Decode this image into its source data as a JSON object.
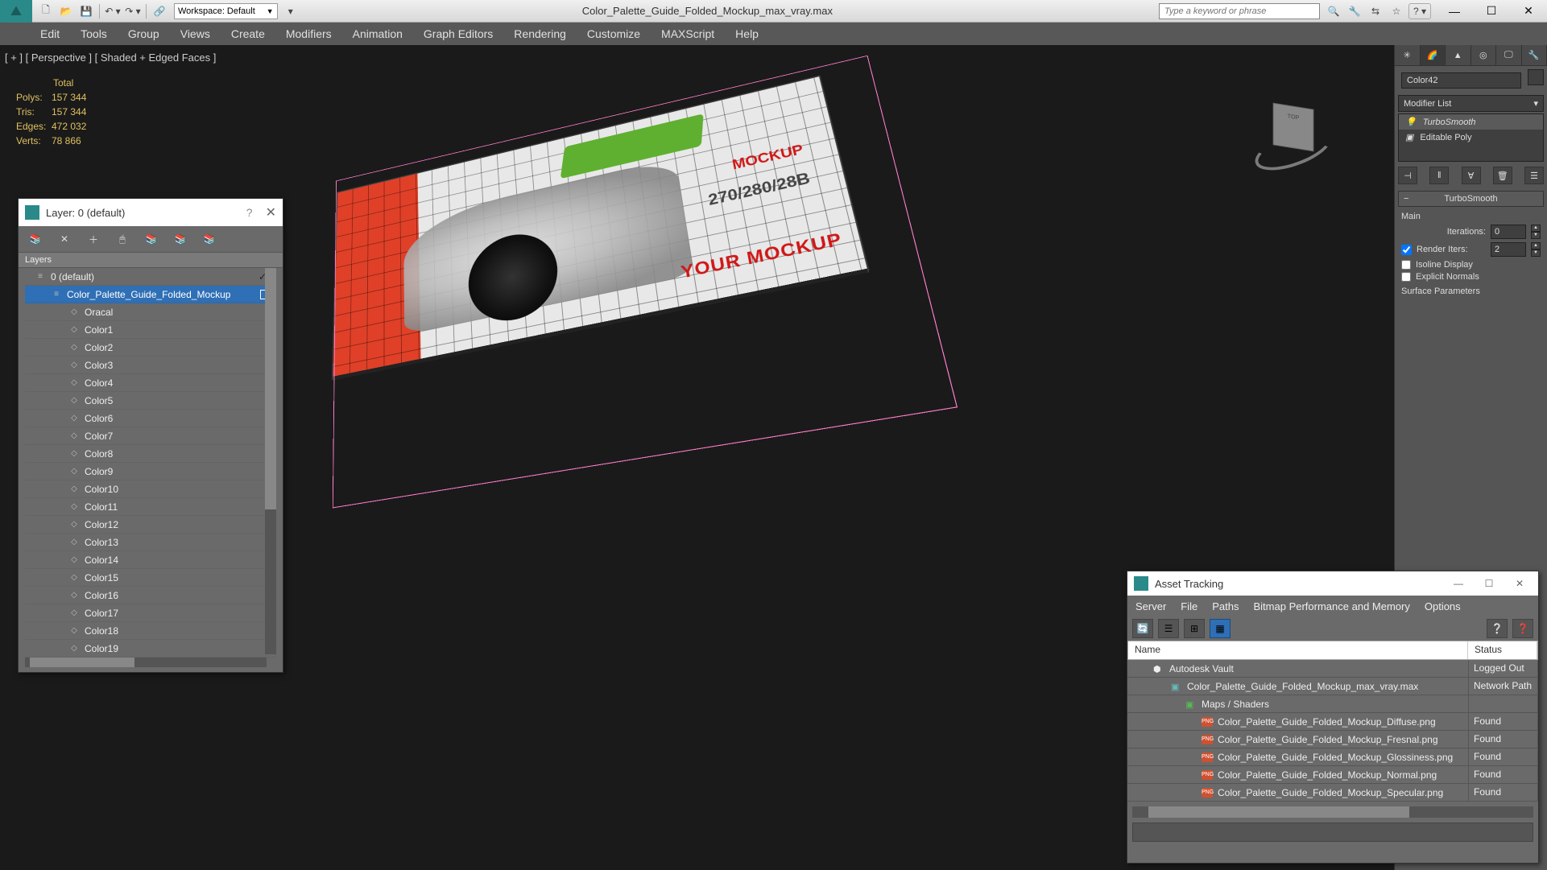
{
  "titlebar": {
    "workspace_label": "Workspace: Default",
    "filename": "Color_Palette_Guide_Folded_Mockup_max_vray.max",
    "search_placeholder": "Type a keyword or phrase"
  },
  "menubar": [
    "Edit",
    "Tools",
    "Group",
    "Views",
    "Create",
    "Modifiers",
    "Animation",
    "Graph Editors",
    "Rendering",
    "Customize",
    "MAXScript",
    "Help"
  ],
  "viewport": {
    "label": "[ + ] [ Perspective ] [ Shaded + Edged Faces ]",
    "stats": {
      "total_label": "Total",
      "polys_label": "Polys:",
      "polys": "157 344",
      "tris_label": "Tris:",
      "tris": "157 344",
      "edges_label": "Edges:",
      "edges": "472 032",
      "verts_label": "Verts:",
      "verts": "78 866"
    },
    "mockup_text1": "YOUR MOCKUP",
    "mockup_text2": "MOCKUP",
    "num_text": "270/280/28B"
  },
  "cmdpanel": {
    "object_name": "Color42",
    "modifier_list_label": "Modifier List",
    "stack": [
      "TurboSmooth",
      "Editable Poly"
    ],
    "rollout_title": "TurboSmooth",
    "main_label": "Main",
    "iterations_label": "Iterations:",
    "iterations_value": "0",
    "render_iters_label": "Render Iters:",
    "render_iters_value": "2",
    "isoline_label": "Isoline Display",
    "explicit_label": "Explicit Normals",
    "surface_label": "Surface Parameters"
  },
  "layer_panel": {
    "title": "Layer: 0 (default)",
    "header": "Layers",
    "items": [
      {
        "name": "0 (default)",
        "type": "root",
        "selected": false
      },
      {
        "name": "Color_Palette_Guide_Folded_Mockup",
        "type": "layer",
        "selected": true
      },
      {
        "name": "Oracal",
        "type": "obj"
      },
      {
        "name": "Color1",
        "type": "obj"
      },
      {
        "name": "Color2",
        "type": "obj"
      },
      {
        "name": "Color3",
        "type": "obj"
      },
      {
        "name": "Color4",
        "type": "obj"
      },
      {
        "name": "Color5",
        "type": "obj"
      },
      {
        "name": "Color6",
        "type": "obj"
      },
      {
        "name": "Color7",
        "type": "obj"
      },
      {
        "name": "Color8",
        "type": "obj"
      },
      {
        "name": "Color9",
        "type": "obj"
      },
      {
        "name": "Color10",
        "type": "obj"
      },
      {
        "name": "Color11",
        "type": "obj"
      },
      {
        "name": "Color12",
        "type": "obj"
      },
      {
        "name": "Color13",
        "type": "obj"
      },
      {
        "name": "Color14",
        "type": "obj"
      },
      {
        "name": "Color15",
        "type": "obj"
      },
      {
        "name": "Color16",
        "type": "obj"
      },
      {
        "name": "Color17",
        "type": "obj"
      },
      {
        "name": "Color18",
        "type": "obj"
      },
      {
        "name": "Color19",
        "type": "obj"
      }
    ]
  },
  "asset_panel": {
    "title": "Asset Tracking",
    "menu": [
      "Server",
      "File",
      "Paths",
      "Bitmap Performance and Memory",
      "Options"
    ],
    "col_name": "Name",
    "col_status": "Status",
    "rows": [
      {
        "name": "Autodesk Vault",
        "status": "Logged Out",
        "indent": 1,
        "icon": "vault"
      },
      {
        "name": "Color_Palette_Guide_Folded_Mockup_max_vray.max",
        "status": "Network Path",
        "indent": 2,
        "icon": "max"
      },
      {
        "name": "Maps / Shaders",
        "status": "",
        "indent": 3,
        "icon": "folder"
      },
      {
        "name": "Color_Palette_Guide_Folded_Mockup_Diffuse.png",
        "status": "Found",
        "indent": 4,
        "icon": "png"
      },
      {
        "name": "Color_Palette_Guide_Folded_Mockup_Fresnal.png",
        "status": "Found",
        "indent": 4,
        "icon": "png"
      },
      {
        "name": "Color_Palette_Guide_Folded_Mockup_Glossiness.png",
        "status": "Found",
        "indent": 4,
        "icon": "png"
      },
      {
        "name": "Color_Palette_Guide_Folded_Mockup_Normal.png",
        "status": "Found",
        "indent": 4,
        "icon": "png"
      },
      {
        "name": "Color_Palette_Guide_Folded_Mockup_Specular.png",
        "status": "Found",
        "indent": 4,
        "icon": "png"
      }
    ]
  }
}
